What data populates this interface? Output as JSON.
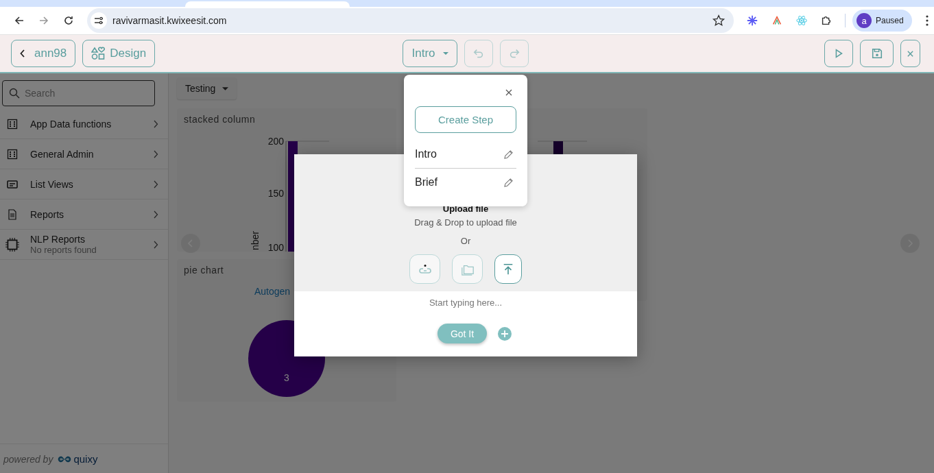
{
  "browser": {
    "url": "ravivarmasit.kwixeesit.com",
    "profile_initial": "a",
    "profile_status": "Paused"
  },
  "header": {
    "back_label": "ann98",
    "design_label": "Design",
    "step_dropdown": "Intro"
  },
  "sidebar": {
    "search_placeholder": "Search",
    "items": [
      {
        "label": "App Data functions"
      },
      {
        "label": "General Admin"
      },
      {
        "label": "List Views"
      },
      {
        "label": "Reports"
      },
      {
        "label": "NLP Reports",
        "subtitle": "No reports found"
      }
    ],
    "powered_by": "powered by",
    "brand": "quixy"
  },
  "main": {
    "filter": "Testing",
    "stacked_card": {
      "title": "stacked column",
      "y_ticks": [
        "200",
        "150",
        "100"
      ],
      "axis_label": "nber"
    },
    "pie_card": {
      "title": "pie chart",
      "legend": "Autogen",
      "slice_label": "3"
    }
  },
  "modal": {
    "title": "Upload file",
    "instruction": "Drag & Drop to upload file",
    "separator": "Or",
    "upload_options": [
      {
        "selected": false
      },
      {
        "selected": false
      },
      {
        "selected": true
      }
    ],
    "input_placeholder": "Start typing here...",
    "confirm_label": "Got It"
  },
  "steps_popover": {
    "create_label": "Create Step",
    "steps": [
      {
        "label": "Intro"
      },
      {
        "label": "Brief"
      }
    ]
  }
}
